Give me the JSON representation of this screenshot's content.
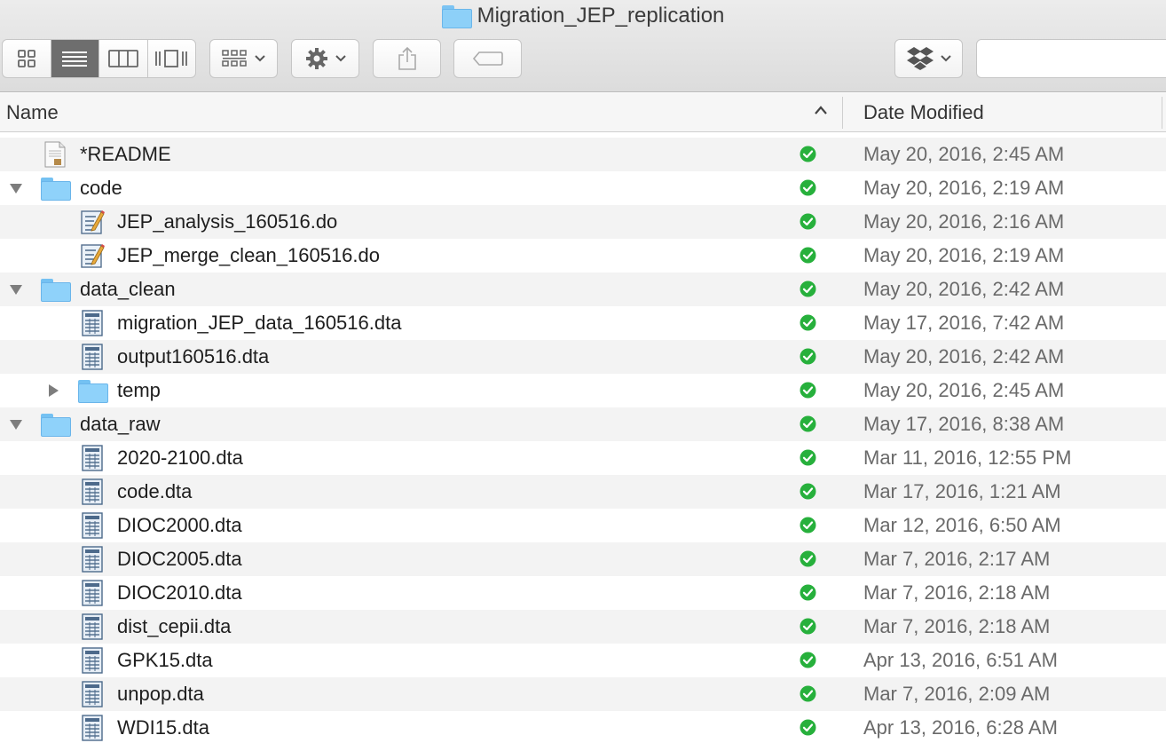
{
  "window": {
    "title": "Migration_JEP_replication"
  },
  "toolbar": {
    "view_icons": [
      "icon-view-icon",
      "list-view-icon",
      "column-view-icon",
      "cover-flow-icon"
    ],
    "active_view": "list-view-icon",
    "arrange_icon": "arrange-icon",
    "action_icon": "gear-icon",
    "share_icon": "share-icon",
    "tag_icon": "tag-icon",
    "dropbox_icon": "dropbox-icon"
  },
  "header": {
    "name": "Name",
    "date_modified": "Date Modified"
  },
  "colors": {
    "check_green": "#27b03c",
    "folder_blue": "#8fd2fa",
    "active_segment": "#6e6e6e"
  },
  "files": [
    {
      "name": "*README",
      "date": "May 20, 2016, 2:45 AM",
      "kind": "text",
      "level": 0,
      "disclosure": "none"
    },
    {
      "name": "code",
      "date": "May 20, 2016, 2:19 AM",
      "kind": "folder",
      "level": 0,
      "disclosure": "open"
    },
    {
      "name": "JEP_analysis_160516.do",
      "date": "May 20, 2016, 2:16 AM",
      "kind": "do",
      "level": 1,
      "disclosure": "none"
    },
    {
      "name": "JEP_merge_clean_160516.do",
      "date": "May 20, 2016, 2:19 AM",
      "kind": "do",
      "level": 1,
      "disclosure": "none"
    },
    {
      "name": "data_clean",
      "date": "May 20, 2016, 2:42 AM",
      "kind": "folder",
      "level": 0,
      "disclosure": "open"
    },
    {
      "name": "migration_JEP_data_160516.dta",
      "date": "May 17, 2016, 7:42 AM",
      "kind": "dta",
      "level": 1,
      "disclosure": "none"
    },
    {
      "name": "output160516.dta",
      "date": "May 20, 2016, 2:42 AM",
      "kind": "dta",
      "level": 1,
      "disclosure": "none"
    },
    {
      "name": "temp",
      "date": "May 20, 2016, 2:45 AM",
      "kind": "folder",
      "level": 1,
      "disclosure": "closed"
    },
    {
      "name": "data_raw",
      "date": "May 17, 2016, 8:38 AM",
      "kind": "folder",
      "level": 0,
      "disclosure": "open"
    },
    {
      "name": "2020-2100.dta",
      "date": "Mar 11, 2016, 12:55 PM",
      "kind": "dta",
      "level": 1,
      "disclosure": "none"
    },
    {
      "name": "code.dta",
      "date": "Mar 17, 2016, 1:21 AM",
      "kind": "dta",
      "level": 1,
      "disclosure": "none"
    },
    {
      "name": "DIOC2000.dta",
      "date": "Mar 12, 2016, 6:50 AM",
      "kind": "dta",
      "level": 1,
      "disclosure": "none"
    },
    {
      "name": "DIOC2005.dta",
      "date": "Mar 7, 2016, 2:17 AM",
      "kind": "dta",
      "level": 1,
      "disclosure": "none"
    },
    {
      "name": "DIOC2010.dta",
      "date": "Mar 7, 2016, 2:18 AM",
      "kind": "dta",
      "level": 1,
      "disclosure": "none"
    },
    {
      "name": "dist_cepii.dta",
      "date": "Mar 7, 2016, 2:18 AM",
      "kind": "dta",
      "level": 1,
      "disclosure": "none"
    },
    {
      "name": "GPK15.dta",
      "date": "Apr 13, 2016, 6:51 AM",
      "kind": "dta",
      "level": 1,
      "disclosure": "none"
    },
    {
      "name": "unpop.dta",
      "date": "Mar 7, 2016, 2:09 AM",
      "kind": "dta",
      "level": 1,
      "disclosure": "none"
    },
    {
      "name": "WDI15.dta",
      "date": "Apr 13, 2016, 6:28 AM",
      "kind": "dta",
      "level": 1,
      "disclosure": "none"
    }
  ]
}
